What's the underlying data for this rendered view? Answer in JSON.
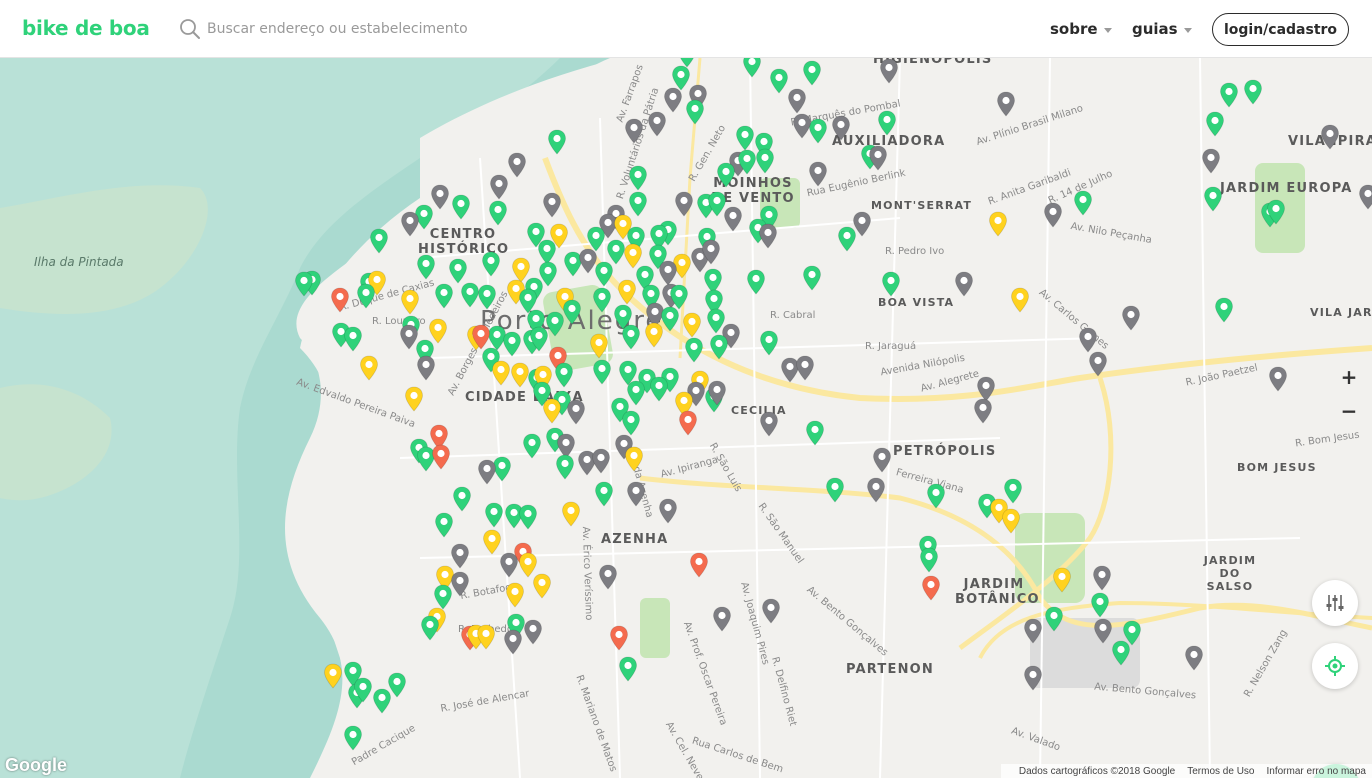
{
  "header": {
    "logo": "bike de boa",
    "search_placeholder": "Buscar endereço ou estabelecimento",
    "nav": [
      {
        "label": "sobre"
      },
      {
        "label": "guias"
      }
    ],
    "login_label": "login/cadastro"
  },
  "colors": {
    "brand_green": "#2fd27a",
    "pin_green": "#2fd27a",
    "pin_gray": "#7d7d82",
    "pin_yellow": "#ffd21f",
    "pin_red": "#f46b4e",
    "water": "#aadad0",
    "park": "#c8e6b8",
    "highway": "#fbe8a0"
  },
  "map": {
    "neighborhoods": [
      "HIGIENÓPOLIS",
      "AUXILIADORA",
      "MOINHOS DE VENTO",
      "MONT'SERRAT",
      "JARDIM EUROPA",
      "CENTRO HISTÓRICO",
      "BOA VISTA",
      "VILA JARDIM",
      "VILA IPIRANGA",
      "CIDADE BAIXA",
      "CECILIA",
      "PETRÓPOLIS",
      "BOM JESUS",
      "AZENHA",
      "JARDIM DO SALSO",
      "JARDIM BOTÂNICO",
      "PARTENON",
      "Porto Alegre"
    ],
    "water_label": "Ilha da Pintada",
    "streets": [
      "Av. Farrapos",
      "R. Voluntários da Pátria",
      "R. Gen. Neto",
      "R. Marquês do Pombal",
      "Av. Plínio Brasil Milano",
      "Rua Eugênio Berlink",
      "R. Anita Garibaldi",
      "R. 14 de Julho",
      "Av. Nilo Peçanha",
      "R. Pedro Ivo",
      "R. Cabral",
      "Avenida Nilópolis",
      "Av. Alegrete",
      "R. Jaraguá",
      "Av. Carlos Gomes",
      "R. João Paetzel",
      "Av. Borges de Medeiros",
      "Av. Edvaldo Pereira Paiva",
      "Av. Ipiranga",
      "R. São Luís",
      "R. São Manuel",
      "R. Bom Jesus",
      "Av. Bento Gonçalves",
      "R. José de Alencar",
      "R. Botafogo",
      "R. Barbedo",
      "Av. Prof. Oscar Pereira",
      "Av. Cel. Neves",
      "Ferreira Viana",
      "R. Mariano de Matos",
      "Av. Valado",
      "Av. Érico Veríssimo",
      "Av. da Azenha",
      "R. Nelson Zang",
      "R. Loureiro",
      "R. Duque de Caxias",
      "Padre Cacique",
      "Rua Carlos de Bem",
      "R. Delfino Riet",
      "Av. Joaquim Pires",
      "Av. Bento Gonçalves"
    ],
    "zoom_in": "+",
    "zoom_out": "−"
  },
  "footer": {
    "google": "Google",
    "map_data": "Dados cartográficos ©2018 Google",
    "terms": "Termos de Uso",
    "report": "Informar erro no mapa"
  }
}
